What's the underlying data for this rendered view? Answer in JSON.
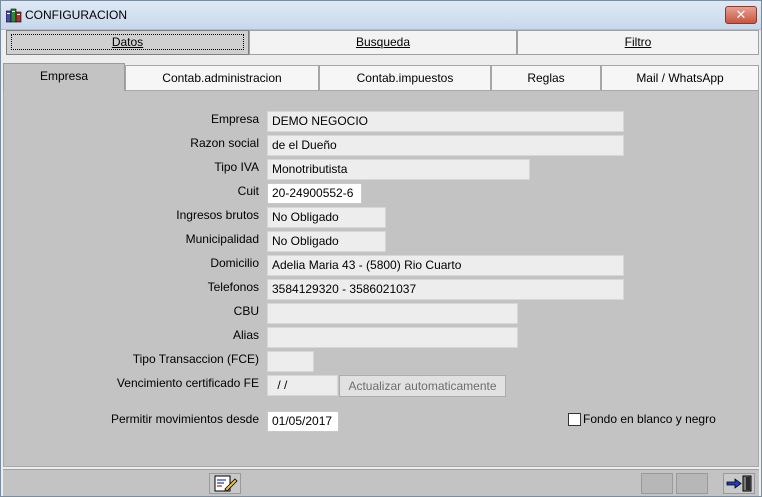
{
  "window": {
    "title": "CONFIGURACION",
    "close_label": "✕"
  },
  "top_tabs": [
    {
      "label": "Datos",
      "active": true
    },
    {
      "label": "Busqueda",
      "active": false
    },
    {
      "label": "Filtro",
      "active": false
    }
  ],
  "sub_tabs": [
    {
      "label": "Empresa",
      "active": true
    },
    {
      "label": "Contab.administracion",
      "active": false
    },
    {
      "label": "Contab.impuestos",
      "active": false
    },
    {
      "label": "Reglas",
      "active": false
    },
    {
      "label": "Mail / WhatsApp",
      "active": false
    }
  ],
  "form": {
    "empresa": {
      "label": "Empresa",
      "value": "DEMO NEGOCIO"
    },
    "razon_social": {
      "label": "Razon social",
      "value": "de el Dueño"
    },
    "tipo_iva": {
      "label": "Tipo IVA",
      "value": "Monotributista"
    },
    "cuit": {
      "label": "Cuit",
      "value": "20-24900552-6"
    },
    "ingresos_brutos": {
      "label": "Ingresos brutos",
      "value": "No Obligado"
    },
    "municipalidad": {
      "label": "Municipalidad",
      "value": "No Obligado"
    },
    "domicilio": {
      "label": "Domicilio",
      "value": "Adelia Maria 43 - (5800) Rio Cuarto"
    },
    "telefonos": {
      "label": "Telefonos",
      "value": "3584129320 - 3586021037"
    },
    "cbu": {
      "label": "CBU",
      "value": ""
    },
    "alias": {
      "label": "Alias",
      "value": ""
    },
    "tipo_transaccion": {
      "label": "Tipo Transaccion (FCE)",
      "value": ""
    },
    "vencimiento": {
      "label": "Vencimiento certificado FE",
      "value": " / /",
      "button": "Actualizar automaticamente"
    },
    "permitir": {
      "label": "Permitir movimientos desde",
      "value": "01/05/2017"
    },
    "fondo": {
      "label": "Fondo en blanco y negro",
      "checked": false
    }
  },
  "icons": {
    "app": "database-icon",
    "bottom_left": "edit-document-icon",
    "bottom_right": "exit-door-icon"
  }
}
